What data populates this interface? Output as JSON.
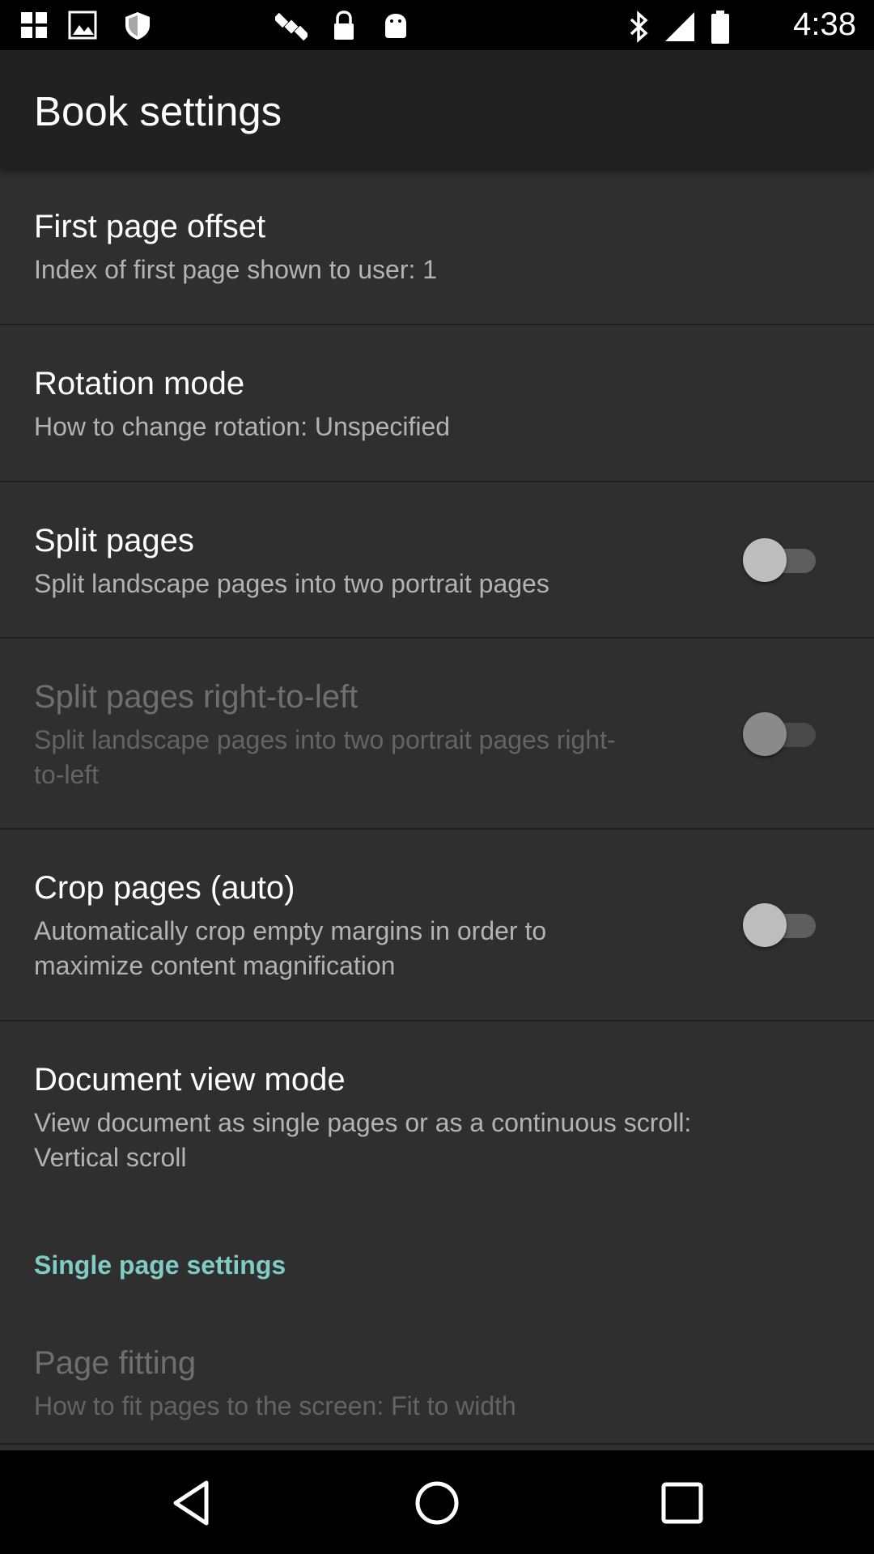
{
  "status_bar": {
    "time": "4:38",
    "left_icons": [
      "app-icon",
      "gallery-icon",
      "shield-icon",
      "satellite-icon",
      "lock-icon",
      "android-icon"
    ],
    "right_icons": [
      "bluetooth-icon",
      "signal-icon",
      "battery-icon"
    ]
  },
  "app_bar": {
    "title": "Book settings"
  },
  "settings": {
    "first_page_offset": {
      "title": "First page offset",
      "summary": "Index of first page shown to user: 1"
    },
    "rotation_mode": {
      "title": "Rotation mode",
      "summary": "How to change rotation: Unspecified"
    },
    "split_pages": {
      "title": "Split pages",
      "summary": "Split landscape pages into two portrait pages",
      "enabled": false
    },
    "split_pages_rtl": {
      "title": "Split pages right-to-left",
      "summary_line1": "Split landscape pages into two portrait pages right-",
      "summary_line2": "to-left",
      "enabled": false,
      "disabled": true
    },
    "crop_pages": {
      "title": "Crop pages (auto)",
      "summary_line1": "Automatically crop empty margins in order to",
      "summary_line2": "maximize content magnification",
      "enabled": false
    },
    "document_view_mode": {
      "title": "Document view mode",
      "summary_line1": "View document as single pages or as a continuous scroll:",
      "summary_line2": "Vertical scroll"
    }
  },
  "section": {
    "header": "Single page settings"
  },
  "page_fitting": {
    "title": "Page fitting",
    "summary": "How to fit pages to the screen: Fit to width",
    "disabled": true
  },
  "nav_bar": {
    "icons": [
      "back-icon",
      "home-icon",
      "recents-icon"
    ]
  },
  "colors": {
    "accent": "#80cbc4",
    "background": "#2f2f2f",
    "app_bar": "#212121"
  }
}
